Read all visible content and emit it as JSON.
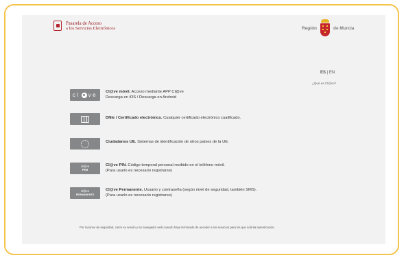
{
  "header": {
    "brand_line1": "Pasarela de Acceso",
    "brand_line2": "a los Servicios Electrónicos",
    "region_left": "Región",
    "region_right": "de Murcia"
  },
  "lang": {
    "es": "ES",
    "sep": " | ",
    "en": "EN"
  },
  "whatis_link": "¿Qué es Cl@ve?",
  "methods": [
    {
      "icon_text": "cl@ve",
      "title": "Cl@ve móvil.",
      "desc": " Acceso mediante APP Cl@ve",
      "line2": "Descarga en iOS  / Descarga en Android"
    },
    {
      "title": "DNIe / Certificado electrónico.",
      "desc": " Cualquier certificado electrónico cualificado."
    },
    {
      "title": "Ciudadanos UE.",
      "desc": " Sistemas de identificación de otros países de la UE."
    },
    {
      "icon_top": "cl@ve",
      "icon_bottom": "PIN",
      "title": "Cl@ve PIN.",
      "desc": " Código temporal personal recibido en el teléfono móvil.",
      "line2": "(Para usarlo es necesario registrarse)"
    },
    {
      "icon_top": "cl@ve",
      "icon_bottom": "PERMANENTE",
      "title": "Cl@ve Permanente.",
      "desc": " Usuario y contraseña (según nivel de seguridad, también SMS).",
      "line2": "(Para usarlo es necesario registrarse)"
    }
  ],
  "footer": "Por razones de seguridad, cierre su sesión y su navegador web cuando haya terminado de acceder a los servicios para los que solicita autenticación.",
  "colors": {
    "frame": "#f5c24a",
    "button": "#858788",
    "brand": "#9d2026"
  }
}
